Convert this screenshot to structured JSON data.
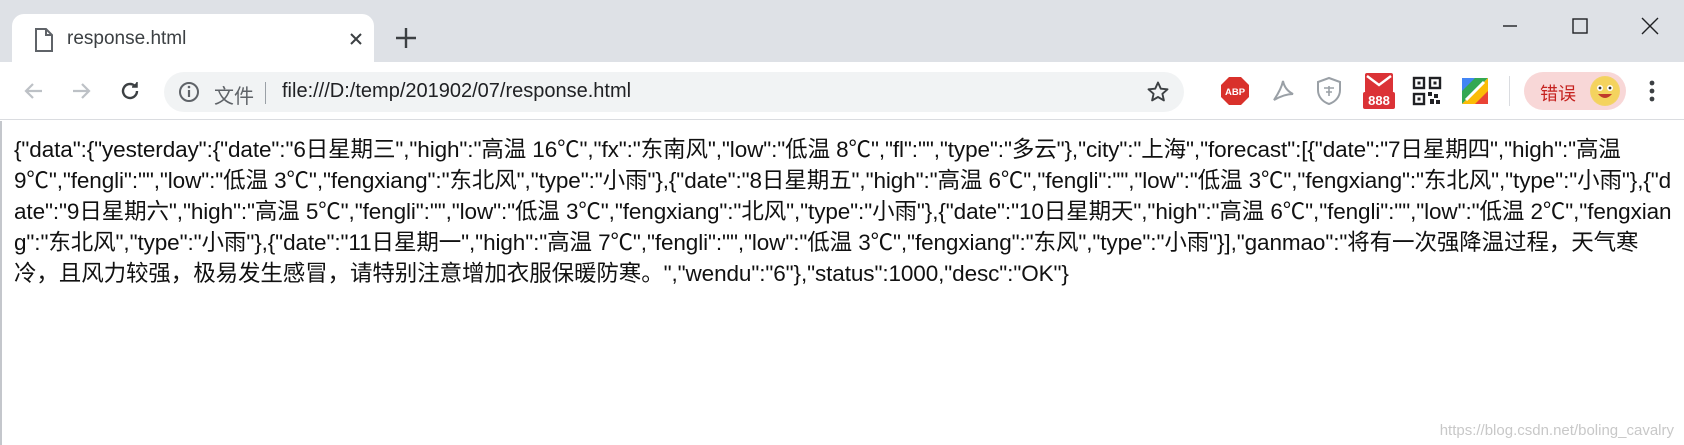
{
  "tab": {
    "title": "response.html"
  },
  "omnibox": {
    "scheme_label": "文件",
    "url": "file:///D:/temp/201902/07/response.html"
  },
  "extensions": {
    "abp_label": "ABP",
    "mail_badge": "888"
  },
  "profile": {
    "label": "错误"
  },
  "page": {
    "json_text": "{\"data\":{\"yesterday\":{\"date\":\"6日星期三\",\"high\":\"高温 16℃\",\"fx\":\"东南风\",\"low\":\"低温 8℃\",\"fl\":\"\",\"type\":\"多云\"},\"city\":\"上海\",\"forecast\":[{\"date\":\"7日星期四\",\"high\":\"高温 9℃\",\"fengli\":\"\",\"low\":\"低温 3℃\",\"fengxiang\":\"东北风\",\"type\":\"小雨\"},{\"date\":\"8日星期五\",\"high\":\"高温 6℃\",\"fengli\":\"\",\"low\":\"低温 3℃\",\"fengxiang\":\"东北风\",\"type\":\"小雨\"},{\"date\":\"9日星期六\",\"high\":\"高温 5℃\",\"fengli\":\"\",\"low\":\"低温 3℃\",\"fengxiang\":\"北风\",\"type\":\"小雨\"},{\"date\":\"10日星期天\",\"high\":\"高温 6℃\",\"fengli\":\"\",\"low\":\"低温 2℃\",\"fengxiang\":\"东北风\",\"type\":\"小雨\"},{\"date\":\"11日星期一\",\"high\":\"高温 7℃\",\"fengli\":\"\",\"low\":\"低温 3℃\",\"fengxiang\":\"东风\",\"type\":\"小雨\"}],\"ganmao\":\"将有一次强降温过程，天气寒冷，且风力较强，极易发生感冒，请特别注意增加衣服保暖防寒。\",\"wendu\":\"6\"},\"status\":1000,\"desc\":\"OK\"}",
    "watermark": "https://blog.csdn.net/boling_cavalry"
  },
  "colors": {
    "tabstrip_bg": "#dee1e6",
    "omnibox_bg": "#f1f3f4",
    "profile_bg": "#f8d7d7",
    "profile_text": "#c5221f",
    "abp_red": "#d9312b",
    "gmail_red": "#db3236"
  },
  "icons": {
    "tab": "document-icon",
    "close": "close-icon",
    "new_tab": "plus-icon",
    "minimize": "minimize-icon",
    "maximize": "maximize-icon",
    "window_close": "window-close-icon",
    "back": "back-arrow-icon",
    "forward": "forward-arrow-icon",
    "reload": "reload-icon",
    "info": "info-icon",
    "bookmark": "star-icon",
    "pdf": "pdf-icon",
    "shield": "shield-icon",
    "mail": "gmail-icon",
    "qr": "qr-code-icon",
    "drive": "color-square-icon",
    "avatar": "smiley-avatar-icon",
    "menu": "kebab-menu-icon"
  }
}
